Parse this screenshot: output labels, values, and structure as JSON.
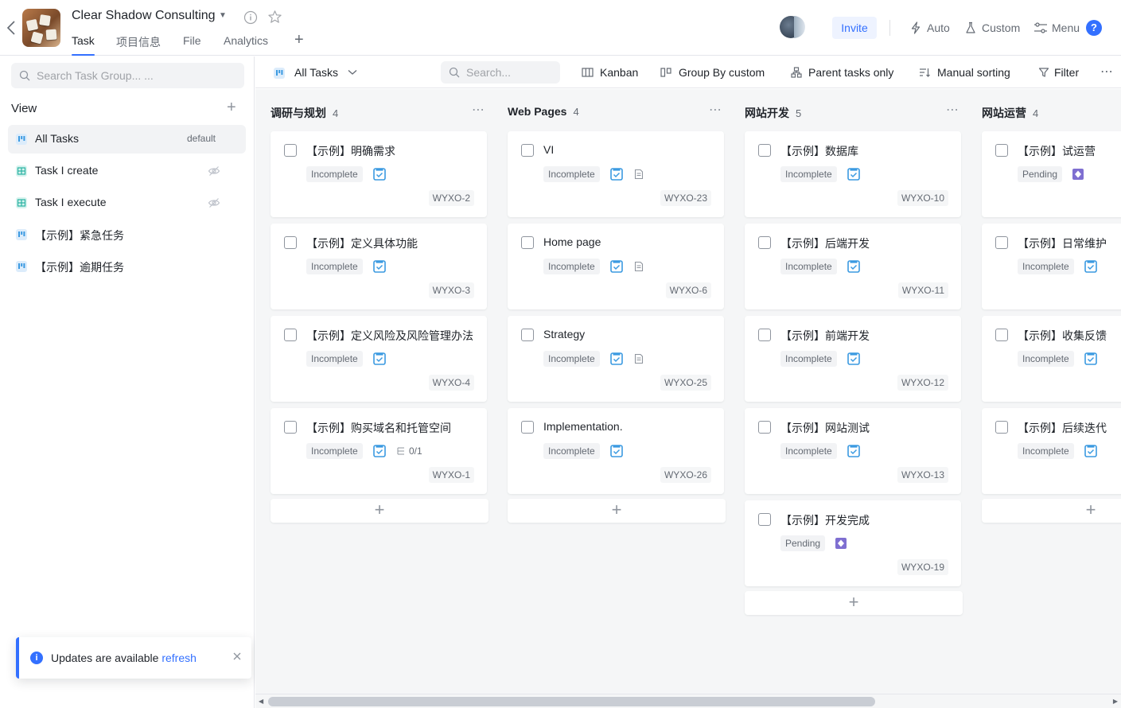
{
  "header": {
    "project_title": "Clear Shadow Consulting",
    "tabs": [
      {
        "label": "Task"
      },
      {
        "label": "项目信息"
      },
      {
        "label": "File"
      },
      {
        "label": "Analytics"
      }
    ],
    "invite_label": "Invite",
    "actions": {
      "auto": "Auto",
      "custom": "Custom",
      "menu": "Menu"
    },
    "help_label": "?"
  },
  "sidebar": {
    "search_placeholder": "Search Task Group... ...",
    "view_title": "View",
    "items": [
      {
        "label": "All Tasks",
        "badge": "default",
        "icon": "kanban-icon"
      },
      {
        "label": "Task I create",
        "icon": "table-icon"
      },
      {
        "label": "Task I execute",
        "icon": "table-icon"
      },
      {
        "label": "【示例】紧急任务",
        "icon": "kanban-icon"
      },
      {
        "label": "【示例】逾期任务",
        "icon": "kanban-icon"
      }
    ]
  },
  "toast": {
    "message": "Updates are available",
    "link": "refresh"
  },
  "toolbar": {
    "view_selector": "All Tasks",
    "search_placeholder": "Search...",
    "kanban": "Kanban",
    "group_by": "Group By custom",
    "parent_only": "Parent tasks only",
    "sorting": "Manual sorting",
    "filter": "Filter"
  },
  "columns": [
    {
      "title": "调研与规划",
      "count": "4",
      "cards": [
        {
          "title": "【示例】明确需求",
          "status": "Incomplete",
          "type": "task",
          "code": "WYXO-2"
        },
        {
          "title": "【示例】定义具体功能",
          "status": "Incomplete",
          "type": "task",
          "code": "WYXO-3"
        },
        {
          "title": "【示例】定义风险及风险管理办法",
          "status": "Incomplete",
          "type": "task",
          "code": "WYXO-4"
        },
        {
          "title": "【示例】购买域名和托管空间",
          "status": "Incomplete",
          "type": "task",
          "subtask": "0/1",
          "code": "WYXO-1"
        }
      ]
    },
    {
      "title": "Web Pages",
      "count": "4",
      "cards": [
        {
          "title": "VI",
          "status": "Incomplete",
          "type": "task",
          "has_doc": true,
          "code": "WYXO-23"
        },
        {
          "title": "Home page",
          "status": "Incomplete",
          "type": "task",
          "has_doc": true,
          "code": "WYXO-6"
        },
        {
          "title": "Strategy",
          "status": "Incomplete",
          "type": "task",
          "has_doc": true,
          "code": "WYXO-25"
        },
        {
          "title": "Implementation.",
          "status": "Incomplete",
          "type": "task",
          "code": "WYXO-26"
        }
      ]
    },
    {
      "title": "网站开发",
      "count": "5",
      "cards": [
        {
          "title": "【示例】数据库",
          "status": "Incomplete",
          "type": "task",
          "code": "WYXO-10"
        },
        {
          "title": "【示例】后端开发",
          "status": "Incomplete",
          "type": "task",
          "code": "WYXO-11"
        },
        {
          "title": "【示例】前端开发",
          "status": "Incomplete",
          "type": "task",
          "code": "WYXO-12"
        },
        {
          "title": "【示例】网站测试",
          "status": "Incomplete",
          "type": "task",
          "code": "WYXO-13"
        },
        {
          "title": "【示例】开发完成",
          "status": "Pending",
          "type": "milestone",
          "code": "WYXO-19"
        }
      ]
    },
    {
      "title": "网站运营",
      "count": "4",
      "cards": [
        {
          "title": "【示例】试运营",
          "status": "Pending",
          "type": "milestone",
          "code": ""
        },
        {
          "title": "【示例】日常维护",
          "status": "Incomplete",
          "type": "task",
          "code": ""
        },
        {
          "title": "【示例】收集反馈",
          "status": "Incomplete",
          "type": "task",
          "code": ""
        },
        {
          "title": "【示例】后续迭代",
          "status": "Incomplete",
          "type": "task",
          "code": ""
        }
      ]
    }
  ],
  "colors": {
    "accent": "#3370ff",
    "milestone": "#7f6fd1",
    "task_icon": "#3b9ae1"
  }
}
